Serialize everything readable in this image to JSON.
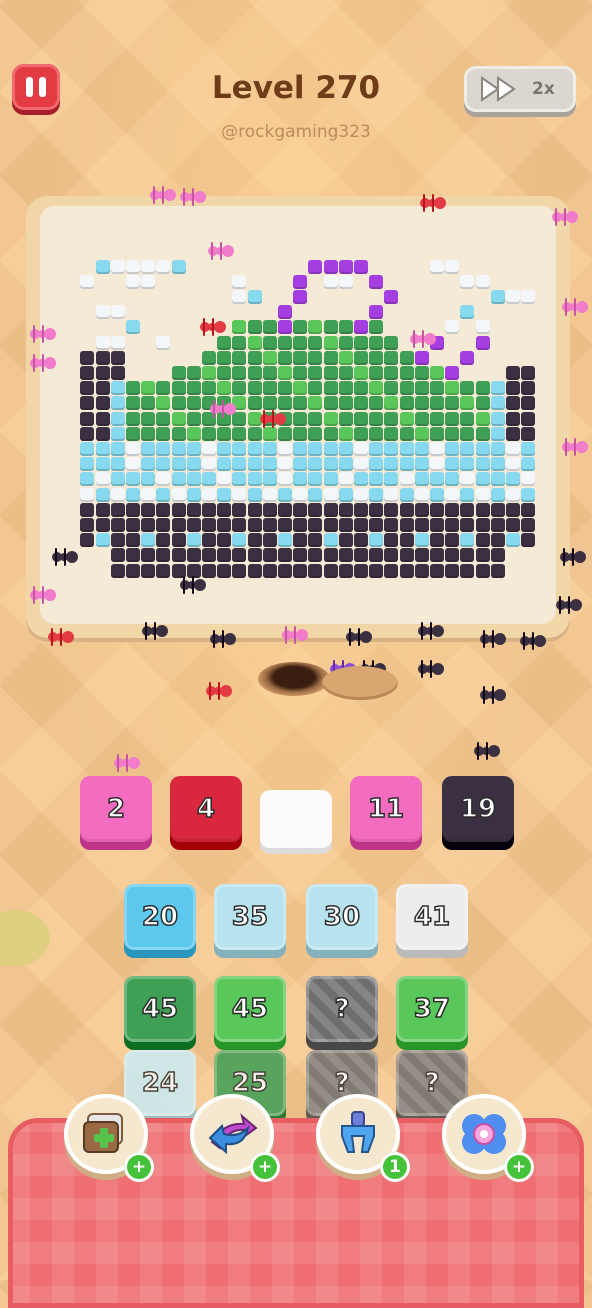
{
  "header": {
    "level_title": "Level 270",
    "watermark": "@rockgaming323",
    "speed_label": "2x"
  },
  "queue": [
    {
      "value": "2",
      "color": "#f36cbf"
    },
    {
      "value": "4",
      "color": "#d9283e"
    },
    {
      "value": "",
      "color": "#fbfbfb"
    },
    {
      "value": "11",
      "color": "#f36cbf"
    },
    {
      "value": "19",
      "color": "#3b2f42"
    }
  ],
  "grid": [
    [
      {
        "value": "20",
        "color": "#5cc8ee"
      },
      {
        "value": "35",
        "color": "#b7e3ef"
      },
      {
        "value": "30",
        "color": "#b7e3ef"
      },
      {
        "value": "41",
        "color": "#ececec"
      }
    ],
    [
      {
        "value": "45",
        "color": "#3e9f55"
      },
      {
        "value": "45",
        "color": "#5ac75a"
      },
      {
        "value": "?",
        "color": "#7a7a7a"
      },
      {
        "value": "37",
        "color": "#5ac75a"
      }
    ],
    [
      {
        "value": "24",
        "color": "#c9ecf6"
      },
      {
        "value": "25",
        "color": "#3e9f55"
      },
      {
        "value": "?",
        "color": "#7a7a7a"
      },
      {
        "value": "?",
        "color": "#7a7a7a"
      }
    ]
  ],
  "boosters": [
    {
      "icon": "add-tile-icon",
      "badge": "+"
    },
    {
      "icon": "swap-arrows-icon",
      "badge": "+"
    },
    {
      "icon": "magnet-claw-icon",
      "badge": "1"
    },
    {
      "icon": "flower-icon",
      "badge": "+"
    }
  ],
  "colors": {
    "dark": "#3b2f42",
    "green": "#3e9f55",
    "lightgreen": "#5ac75a",
    "cyan": "#86d9ee",
    "white": "#f3f7fa",
    "purple": "#a53ee0",
    "pink": "#f56cc8",
    "red": "#e23b44"
  }
}
